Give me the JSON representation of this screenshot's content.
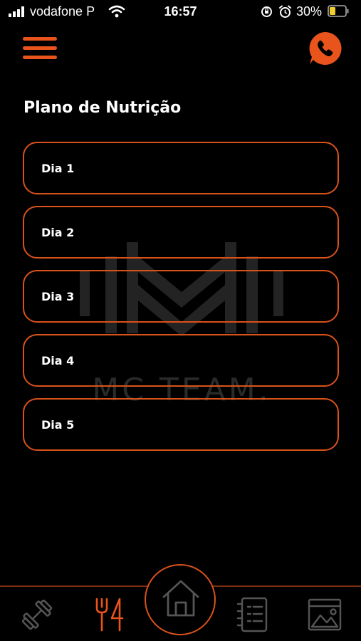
{
  "status_bar": {
    "carrier": "vodafone P",
    "time": "16:57",
    "battery": "30%",
    "icons": [
      "signal-icon",
      "wifi-icon",
      "rotation-lock-icon",
      "alarm-icon",
      "battery-icon"
    ]
  },
  "header": {
    "menu_icon": "hamburger-menu-icon",
    "call_icon": "phone-icon",
    "title": "Plano de Nutrição"
  },
  "watermark": {
    "text": "MC TEAM."
  },
  "days": [
    {
      "label": "Dia 1"
    },
    {
      "label": "Dia 2"
    },
    {
      "label": "Dia 3"
    },
    {
      "label": "Dia 4"
    },
    {
      "label": "Dia 5"
    }
  ],
  "bottom_nav": {
    "items": [
      {
        "icon": "dumbbell-icon",
        "active": false
      },
      {
        "icon": "fork-knife-icon",
        "active": true
      },
      {
        "icon": "home-icon",
        "active": false
      },
      {
        "icon": "checklist-icon",
        "active": false
      },
      {
        "icon": "gallery-icon",
        "active": false
      }
    ]
  },
  "colors": {
    "accent": "#e8541c",
    "background": "#000000",
    "inactive_icon": "#555555"
  }
}
